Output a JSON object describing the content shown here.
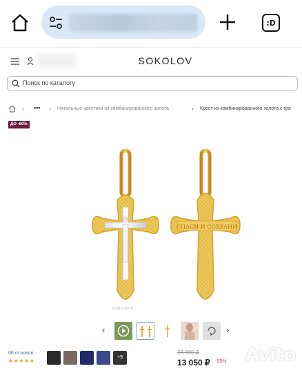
{
  "browser": {
    "tabs_label": ":D"
  },
  "header": {
    "brand": "SOKOLOV"
  },
  "search": {
    "placeholder": "Поиск по каталогу"
  },
  "breadcrumb": {
    "dots": "•••",
    "items": [
      "Нательные крестики из комбинированного золота",
      "Крест из комбинированного золота с гра"
    ]
  },
  "product": {
    "badge": "ДО -60%",
    "reverse_engraving": "СПАСИ И СОХРАНИ",
    "watermark": "…ИТЫ СОКОЛ"
  },
  "thumbnails": {
    "prev_icon": "chevron-left-icon",
    "next_icon": "chevron-right-icon",
    "items": [
      "video",
      "front-back",
      "side",
      "model",
      "360"
    ]
  },
  "reviews": {
    "count_label": "66 отзывов",
    "stars": "★★★★★",
    "rating": 5,
    "more": "+9"
  },
  "price": {
    "old": "28 990 ₽",
    "current": "13 050 ₽",
    "discount": "-55%"
  },
  "watermark": {
    "text": "Avito"
  },
  "colors": {
    "accent_link": "#4a6fa5",
    "badge_bg": "#6b1a3c",
    "gold": "#e8b93a",
    "url_pill": "#d8e8f8"
  }
}
